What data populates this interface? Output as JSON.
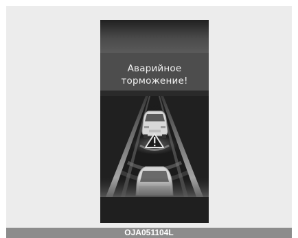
{
  "warning": {
    "line1": "Аварийное",
    "line2": "торможение!"
  },
  "caption": {
    "code": "OJA051104L"
  },
  "icons": {
    "hazard": "warning-triangle-icon"
  },
  "colors": {
    "frame_bg": "#ececec",
    "display_bg": "#202020",
    "caption_bg": "#8c8c8c",
    "text": "#f2f2f2"
  }
}
